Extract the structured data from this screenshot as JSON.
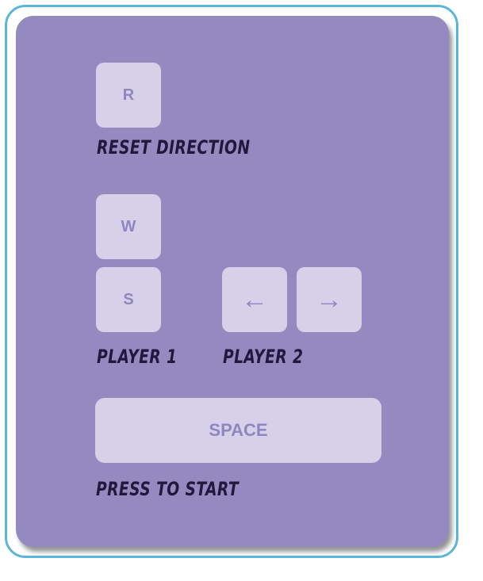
{
  "keys": {
    "reset": "R",
    "p1_up": "W",
    "p1_down": "S",
    "p2_left": "←",
    "p2_right": "→",
    "start": "SPACE"
  },
  "labels": {
    "reset": "RESET DIRECTION",
    "player1": "PLAYER 1",
    "player2": "PLAYER 2",
    "start": "PRESS TO START"
  },
  "colors": {
    "panel": "#948ac0",
    "key": "#d6d1e8",
    "key_text": "#8f86bd",
    "label_text": "#22183e",
    "frame_border": "#5ab6dc"
  }
}
